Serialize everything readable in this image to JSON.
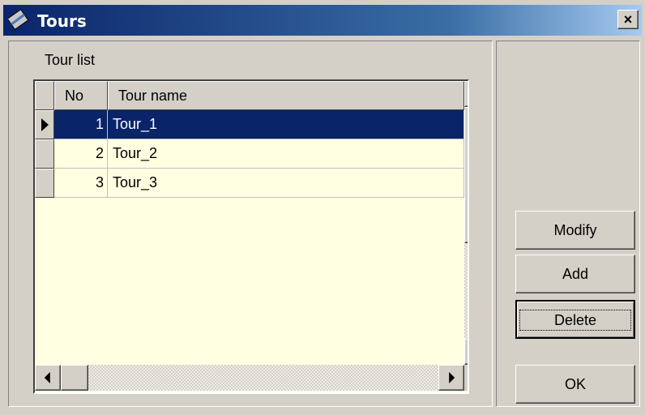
{
  "window": {
    "title": "Tours",
    "close_label": "×"
  },
  "tour_list": {
    "label": "Tour list",
    "columns": [
      "No",
      "Tour name"
    ],
    "rows": [
      {
        "no": "1",
        "name": "Tour_1",
        "selected": true
      },
      {
        "no": "2",
        "name": "Tour_2",
        "selected": false
      },
      {
        "no": "3",
        "name": "Tour_3",
        "selected": false
      }
    ]
  },
  "buttons": {
    "modify": "Modify",
    "add": "Add",
    "delete": "Delete",
    "ok": "OK"
  },
  "colors": {
    "selection": "#0a246a",
    "grid_background": "#ffffe1",
    "face": "#d4d0c8"
  }
}
